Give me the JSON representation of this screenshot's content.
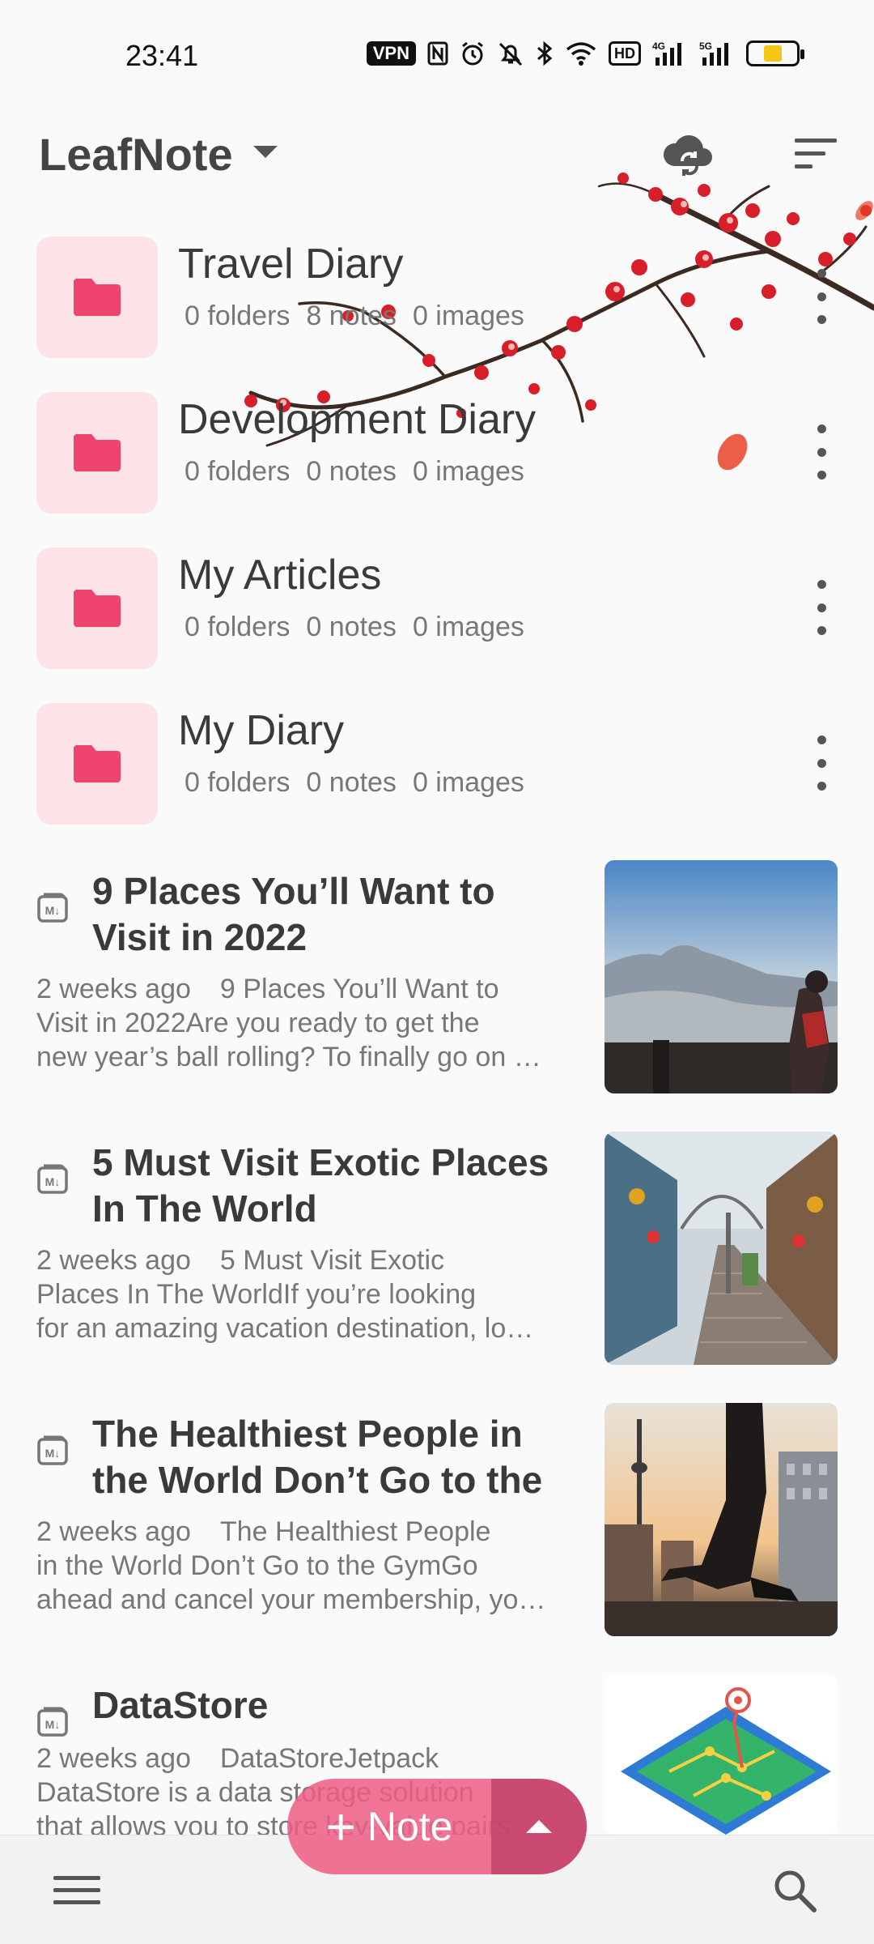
{
  "status_bar": {
    "time": "23:41",
    "vpn": "VPN",
    "hd": "HD",
    "net1": "4G",
    "net2": "5G",
    "icons": [
      "vpn-icon",
      "nfc-icon",
      "alarm-icon",
      "mute-icon",
      "bluetooth-icon",
      "wifi-icon",
      "hd-icon",
      "signal-4g-icon",
      "signal-5g-icon",
      "battery-icon"
    ],
    "battery_level": 0.42
  },
  "app_bar": {
    "title": "LeafNote",
    "icons": [
      "dropdown-caret-icon",
      "cloud-sync-icon",
      "sort-icon"
    ]
  },
  "folders": [
    {
      "name": "Travel Diary",
      "folders": "0 folders",
      "notes": "8 notes",
      "images": "0 images"
    },
    {
      "name": "Development Diary",
      "folders": "0 folders",
      "notes": "0 notes",
      "images": "0 images"
    },
    {
      "name": "My Articles",
      "folders": "0 folders",
      "notes": "0 notes",
      "images": "0 images"
    },
    {
      "name": "My Diary",
      "folders": "0 folders",
      "notes": "0 notes",
      "images": "0 images"
    }
  ],
  "notes": [
    {
      "title": "9 Places You’ll Want to Visit in 2022",
      "time": "2 weeks ago",
      "line1": "9 Places You’ll Want to",
      "line2": "Visit in 2022Are you ready to get the",
      "line3": "new year’s ball rolling? To finally go on …"
    },
    {
      "title": "5 Must Visit Exotic Places In The World",
      "time": "2 weeks ago",
      "line1": "5 Must Visit Exotic",
      "line2": "Places In The WorldIf you’re looking",
      "line3": "for an amazing vacation destination, lo…"
    },
    {
      "title": "The Healthiest People in the World Don’t Go to the",
      "time": "2 weeks ago",
      "line1": "The Healthiest People",
      "line2": "in the World Don’t Go to the GymGo",
      "line3": "ahead and cancel your membership, yo…"
    },
    {
      "title": "DataStore",
      "time": "2 weeks ago",
      "line1": "DataStoreJetpack",
      "line2": "DataStore is a data storage solution",
      "line3": "that allows you to store key-value pairs"
    }
  ],
  "fab": {
    "label": "Note",
    "plus": "+"
  },
  "bottom_bar": {
    "icons": [
      "menu-icon",
      "search-icon"
    ]
  },
  "colors": {
    "accent": "#ec5d84",
    "folder_tile": "#fbe3e8",
    "folder_icon": "#f0436e"
  }
}
